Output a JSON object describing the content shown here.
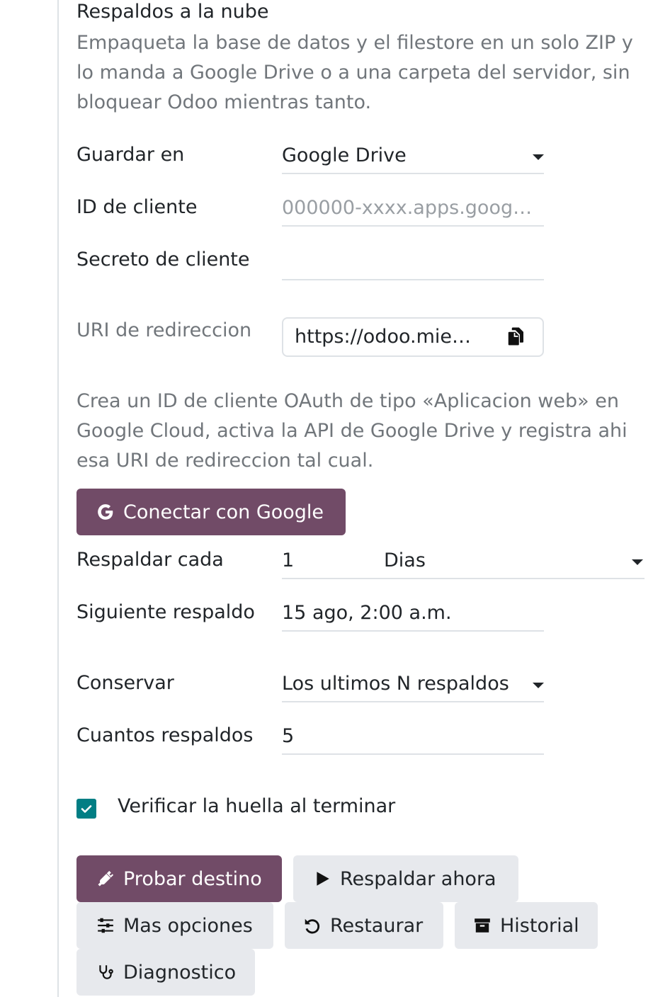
{
  "section": {
    "title": "Respaldos a la nube",
    "description": "Empaqueta la base de datos y el filestore en un solo ZIP y lo manda a Google Drive o a una carpeta del servidor, sin bloquear Odoo mientras tanto."
  },
  "form": {
    "save_to_label": "Guardar en",
    "save_to_value": "Google Drive",
    "client_id_label": "ID de cliente",
    "client_id_placeholder": "000000-xxxx.apps.goog…",
    "client_secret_label": "Secreto de cliente",
    "client_secret_value": "",
    "redirect_uri_label": "URI de redireccion",
    "redirect_uri_value": "https://odoo.mie…",
    "hint": "Crea un ID de cliente OAuth de tipo «Aplicacion web» en Google Cloud, activa la API de Google Drive y registra ahi esa URI de redireccion tal cual.",
    "connect_google_label": "Conectar con Google",
    "backup_every_label": "Respaldar cada",
    "backup_every_value": "1",
    "backup_every_unit": "Dias",
    "next_backup_label": "Siguiente respaldo",
    "next_backup_value": "15 ago, 2:00 a.m.",
    "keep_label": "Conservar",
    "keep_value": "Los ultimos N respaldos",
    "how_many_label": "Cuantos respaldos",
    "how_many_value": "5",
    "verify_label": "Verificar la huella al terminar",
    "verify_checked": true
  },
  "actions": {
    "test_destination": "Probar destino",
    "backup_now": "Respaldar ahora",
    "more_options": "Mas opciones",
    "restore": "Restaurar",
    "history": "Historial",
    "diagnostics": "Diagnostico"
  },
  "colors": {
    "primary": "#714b67",
    "secondary_bg": "#e7e9ed",
    "checkbox": "#017e84",
    "muted_text": "#71767b"
  }
}
